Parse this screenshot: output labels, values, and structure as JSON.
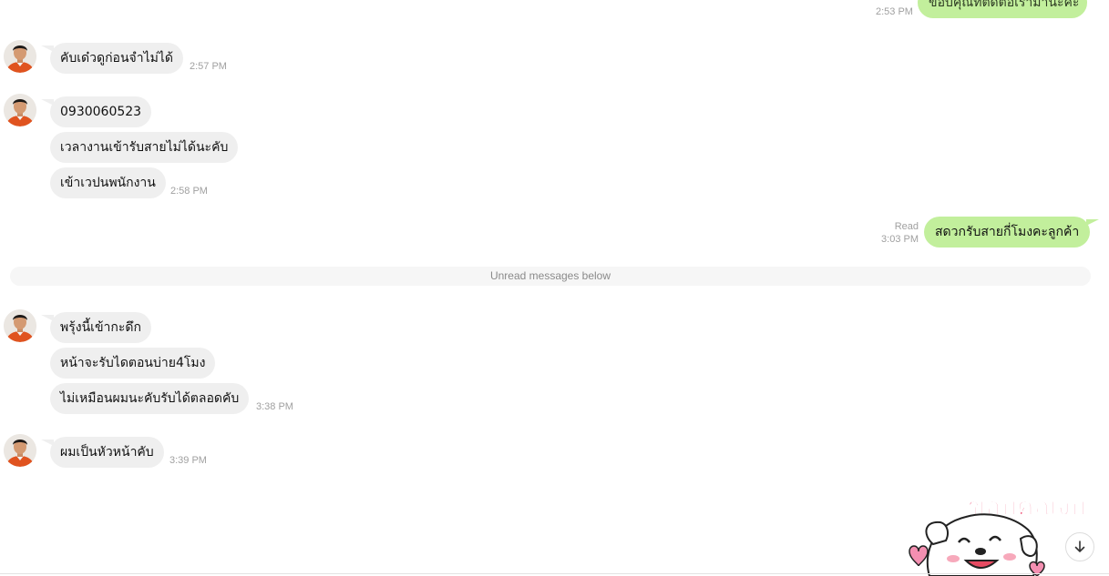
{
  "messages_top": {
    "out_cut": {
      "text": "ขอบคุณที่ติดต่อเรามานะคะ",
      "time": "2:53 PM"
    }
  },
  "group1": {
    "bubbles": [
      "คับเด๋วดูก่อนจำไม่ได้"
    ],
    "time": "2:57 PM"
  },
  "group2": {
    "bubbles": [
      "0930060523",
      "เวลางานเข้ารับสายไม่ได้นะคับ",
      "เข้าเวปนพนักงาน"
    ],
    "time": "2:58 PM"
  },
  "outgoing": {
    "text": "สดวกรับสายกี่โมงคะลูกค้า",
    "status": "Read",
    "time": "3:03 PM"
  },
  "divider": {
    "text": "Unread messages below"
  },
  "group3": {
    "bubbles": [
      "พรุ้งนี้เข้ากะดึก",
      "หน้าจะรับไดตอนบ่าย4โมง",
      "ไม่เหมือนผมนะคับรับได้ตลอดคับ"
    ],
    "time": "3:38 PM"
  },
  "group4": {
    "bubbles": [
      "ผมเป็นหัวหน้าคับ"
    ],
    "time": "3:39 PM"
  },
  "sticker": {
    "text": "ขอบคุณงับ"
  },
  "icons": {
    "scroll": "arrow-down-icon"
  },
  "colors": {
    "outgoing_bubble": "#c2ef9c",
    "incoming_bubble": "#efefef",
    "sticker_text": "#f06a8a"
  }
}
